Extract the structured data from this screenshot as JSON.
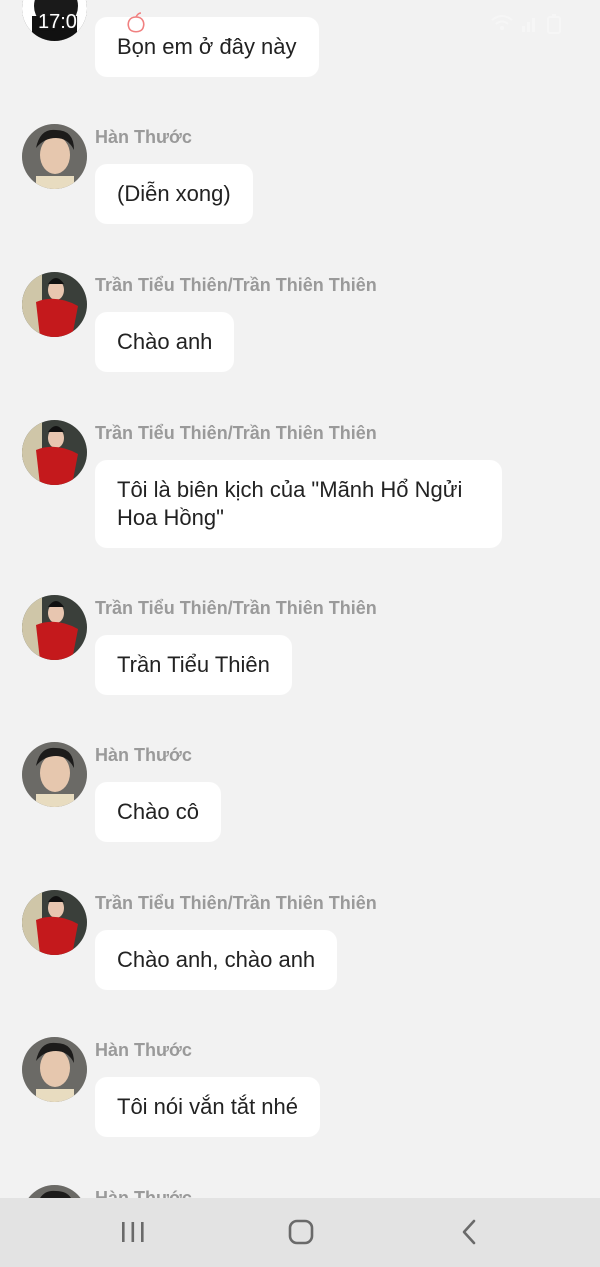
{
  "status_bar": {
    "time": "17:0"
  },
  "messages": [
    {
      "sender": "",
      "text": "Bọn em ở đây này",
      "avatar": "dark-avatar"
    },
    {
      "sender": "Hàn Thước",
      "text": "(Diễn xong)",
      "avatar": "man-avatar"
    },
    {
      "sender": "Trần Tiểu Thiên/Trần Thiên Thiên",
      "text": "Chào anh",
      "avatar": "woman-red-dress-avatar"
    },
    {
      "sender": "Trần Tiểu Thiên/Trần Thiên Thiên",
      "text": "Tôi là biên kịch của \"Mãnh Hổ Ngửi Hoa Hồng\"",
      "avatar": "woman-red-dress-avatar"
    },
    {
      "sender": "Trần Tiểu Thiên/Trần Thiên Thiên",
      "text": "Trần Tiểu Thiên",
      "avatar": "woman-red-dress-avatar"
    },
    {
      "sender": "Hàn Thước",
      "text": "Chào cô",
      "avatar": "man-avatar"
    },
    {
      "sender": "Trần Tiểu Thiên/Trần Thiên Thiên",
      "text": "Chào anh, chào anh",
      "avatar": "woman-red-dress-avatar"
    },
    {
      "sender": "Hàn Thước",
      "text": "Tôi nói vắn tắt nhé",
      "avatar": "man-avatar"
    },
    {
      "sender": "Hàn Thước",
      "text": "",
      "avatar": "man-avatar"
    }
  ],
  "nav_bar": {
    "icons": [
      "recent-apps-icon",
      "home-icon",
      "back-icon"
    ]
  },
  "colors": {
    "background": "#f2f2f2",
    "bubble": "#ffffff",
    "sender": "#9a9a9a",
    "text": "#222222",
    "navbar": "#e3e3e3"
  }
}
